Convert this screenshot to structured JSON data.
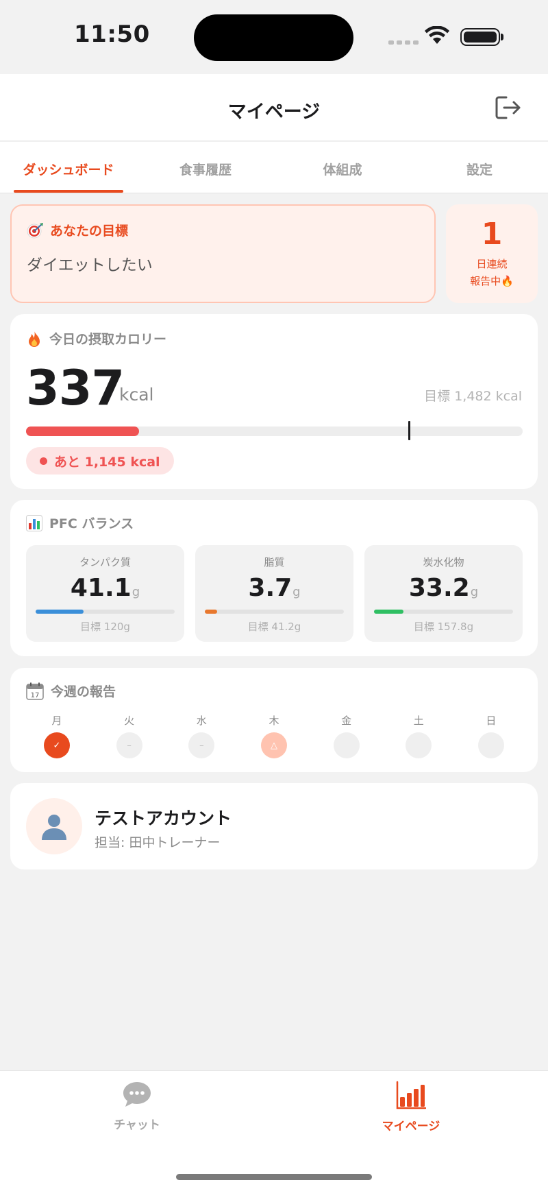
{
  "status_bar": {
    "time": "11:50"
  },
  "header": {
    "title": "マイページ"
  },
  "tabs": [
    {
      "label": "ダッシュボード",
      "active": true
    },
    {
      "label": "食事履歴"
    },
    {
      "label": "体組成"
    },
    {
      "label": "設定"
    }
  ],
  "goal": {
    "icon": "target-icon",
    "label": "あなたの目標",
    "text": "ダイエットしたい"
  },
  "streak": {
    "count": "1",
    "line1": "日連続",
    "line2": "報告中🔥"
  },
  "calories": {
    "icon": "fire-icon",
    "label": "今日の摂取カロリー",
    "value": "337",
    "unit": "kcal",
    "target_text": "目標 1,482 kcal",
    "progress_fraction": 0.227,
    "marker_fraction": 0.77,
    "remaining_text": "あと 1,145 kcal",
    "accent_color": "#ef5353"
  },
  "pfc": {
    "icon": "bar-chart-icon",
    "label": "PFC バランス",
    "items": [
      {
        "name": "タンパク質",
        "value": "41.1",
        "unit": "g",
        "target": "目標 120g",
        "fraction": 0.343,
        "color": "#3b8fd9"
      },
      {
        "name": "脂質",
        "value": "3.7",
        "unit": "g",
        "target": "目標 41.2g",
        "fraction": 0.09,
        "color": "#e8782e"
      },
      {
        "name": "炭水化物",
        "value": "33.2",
        "unit": "g",
        "target": "目標 157.8g",
        "fraction": 0.21,
        "color": "#2fbf63"
      }
    ]
  },
  "weekly": {
    "icon": "calendar-icon",
    "label": "今週の報告",
    "days": [
      {
        "name": "月",
        "status": "done",
        "mark": "✓"
      },
      {
        "name": "火",
        "status": "none",
        "mark": "–"
      },
      {
        "name": "水",
        "status": "none",
        "mark": "–"
      },
      {
        "name": "木",
        "status": "partial",
        "mark": "△"
      },
      {
        "name": "金",
        "status": "empty",
        "mark": ""
      },
      {
        "name": "土",
        "status": "empty",
        "mark": ""
      },
      {
        "name": "日",
        "status": "empty",
        "mark": ""
      }
    ]
  },
  "profile": {
    "name": "テストアカウント",
    "subtitle": "担当: 田中トレーナー",
    "avatar_icon": "person-icon"
  },
  "bottom_nav": [
    {
      "label": "チャット",
      "icon": "chat-bubble-icon",
      "active": false
    },
    {
      "label": "マイページ",
      "icon": "bar-chart-icon",
      "active": true
    }
  ],
  "colors": {
    "accent": "#e84a1e",
    "background": "#f2f2f2"
  }
}
